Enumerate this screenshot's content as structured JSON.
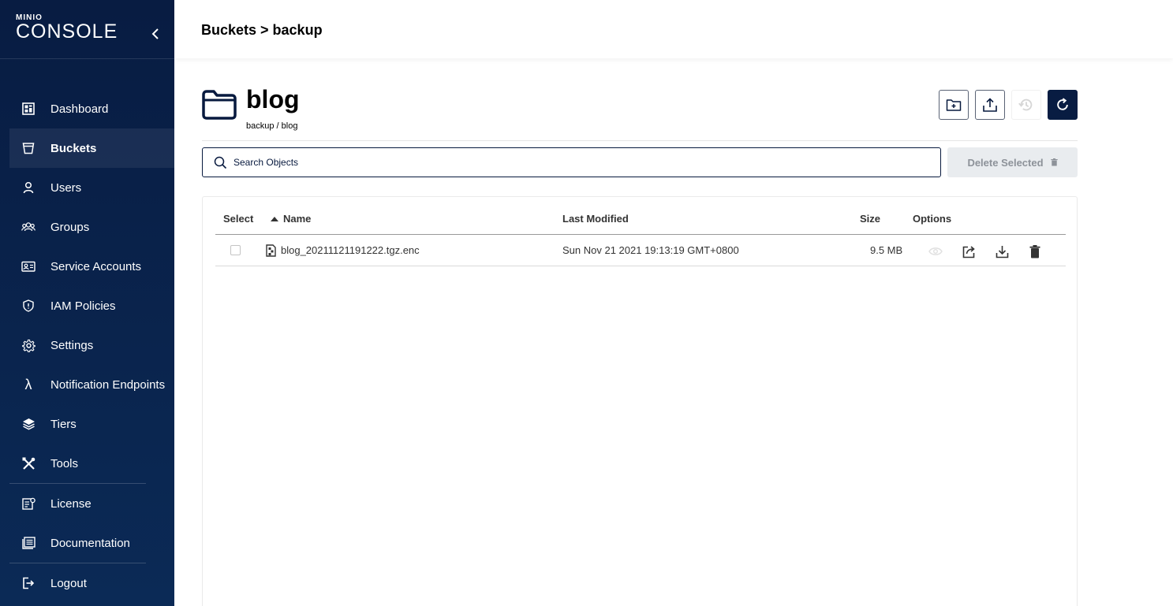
{
  "sidebar": {
    "logo_top": "MINIO",
    "logo_bottom": "CONSOLE",
    "items": [
      {
        "label": "Dashboard"
      },
      {
        "label": "Buckets"
      },
      {
        "label": "Users"
      },
      {
        "label": "Groups"
      },
      {
        "label": "Service Accounts"
      },
      {
        "label": "IAM Policies"
      },
      {
        "label": "Settings"
      },
      {
        "label": "Notification Endpoints"
      },
      {
        "label": "Tiers"
      },
      {
        "label": "Tools"
      },
      {
        "label": "License"
      },
      {
        "label": "Documentation"
      },
      {
        "label": "Logout"
      }
    ],
    "active": "Buckets"
  },
  "header": {
    "breadcrumb": "Buckets > backup"
  },
  "bucket": {
    "name": "blog",
    "path": "backup / blog"
  },
  "search": {
    "placeholder": "Search Objects",
    "value": ""
  },
  "actions": {
    "delete_label": "Delete Selected"
  },
  "table": {
    "columns": {
      "select": "Select",
      "name": "Name",
      "modified": "Last Modified",
      "size": "Size",
      "options": "Options"
    },
    "sort": {
      "column": "Name",
      "direction": "asc"
    },
    "rows": [
      {
        "name": "blog_20211121191222.tgz.enc",
        "modified": "Sun Nov 21 2021 19:13:19 GMT+0800",
        "size": "9.5 MB"
      }
    ]
  },
  "colors": {
    "navy": "#081c42",
    "text": "#07193e",
    "disabled": "#8d9299"
  }
}
